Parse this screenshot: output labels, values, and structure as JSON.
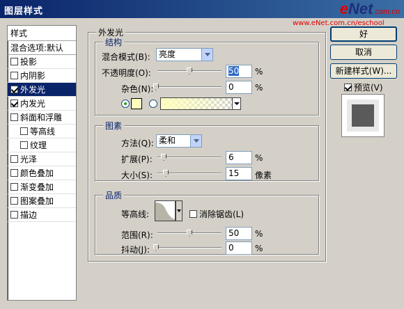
{
  "window": {
    "title": "图层样式"
  },
  "watermark": {
    "logo_prefix": "e",
    "logo_main": "Net",
    "logo_suffix": ".com.cn",
    "url": "www.eNet.com.cn/eschool"
  },
  "style_list": {
    "header": "样式",
    "blend_options": "混合选项:默认",
    "items": [
      {
        "label": "投影",
        "checked": false,
        "indent": false,
        "selected": false
      },
      {
        "label": "内阴影",
        "checked": false,
        "indent": false,
        "selected": false
      },
      {
        "label": "外发光",
        "checked": true,
        "indent": false,
        "selected": true
      },
      {
        "label": "内发光",
        "checked": true,
        "indent": false,
        "selected": false
      },
      {
        "label": "斜面和浮雕",
        "checked": false,
        "indent": false,
        "selected": false
      },
      {
        "label": "等高线",
        "checked": false,
        "indent": true,
        "selected": false
      },
      {
        "label": "纹理",
        "checked": false,
        "indent": true,
        "selected": false
      },
      {
        "label": "光泽",
        "checked": false,
        "indent": false,
        "selected": false
      },
      {
        "label": "颜色叠加",
        "checked": false,
        "indent": false,
        "selected": false
      },
      {
        "label": "渐变叠加",
        "checked": false,
        "indent": false,
        "selected": false
      },
      {
        "label": "图案叠加",
        "checked": false,
        "indent": false,
        "selected": false
      },
      {
        "label": "描边",
        "checked": false,
        "indent": false,
        "selected": false
      }
    ]
  },
  "outer_glow": {
    "title": "外发光",
    "structure": {
      "title": "结构",
      "blend_mode_label": "混合模式(B):",
      "blend_mode_value": "亮度",
      "opacity_label": "不透明度(O):",
      "opacity_value": "50",
      "opacity_percent": 0.5,
      "noise_label": "杂色(N):",
      "noise_value": "0",
      "noise_percent": 0.0,
      "unit": "%",
      "glow_color": "#ffffbe"
    },
    "elements": {
      "title": "图素",
      "technique_label": "方法(Q):",
      "technique_value": "柔和",
      "spread_label": "扩展(P):",
      "spread_value": "6",
      "spread_percent": 0.06,
      "size_label": "大小(S):",
      "size_value": "15",
      "size_unit": "像素",
      "unit": "%"
    },
    "quality": {
      "title": "品质",
      "contour_label": "等高线:",
      "antialias_label": "消除锯齿(L)",
      "range_label": "范围(R):",
      "range_value": "50",
      "range_percent": 0.5,
      "jitter_label": "抖动(J):",
      "jitter_value": "0",
      "jitter_percent": 0.0,
      "unit": "%"
    }
  },
  "buttons": {
    "ok": "好",
    "cancel": "取消",
    "new_style": "新建样式(W)...",
    "preview_label": "预览(V)",
    "preview_checked": true
  }
}
